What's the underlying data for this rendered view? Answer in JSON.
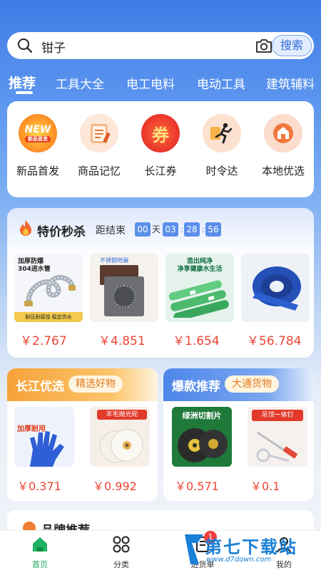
{
  "search": {
    "query": "钳子",
    "button_label": "搜索"
  },
  "tabs": [
    {
      "label": "推荐",
      "active": true
    },
    {
      "label": "工具大全"
    },
    {
      "label": "电工电料"
    },
    {
      "label": "电动工具"
    },
    {
      "label": "建筑辅料"
    }
  ],
  "shortcuts": [
    {
      "label": "新品首发",
      "badge_text": "NEW",
      "badge_sub": "新品首发",
      "icon": "new-badge-icon"
    },
    {
      "label": "商品记忆",
      "icon": "memory-notebook-icon"
    },
    {
      "label": "长江券",
      "badge_text": "券",
      "icon": "coupon-icon"
    },
    {
      "label": "时令达",
      "icon": "runner-icon"
    },
    {
      "label": "本地优选",
      "icon": "local-store-icon"
    }
  ],
  "flash_sale": {
    "title": "特价秒杀",
    "countdown_label": "距结束",
    "days": "00",
    "day_unit": "天",
    "hours": "03",
    "minutes": "28",
    "seconds": "56",
    "products": [
      {
        "price": "￥2.767",
        "caption_top": "加厚防爆",
        "caption_top2": "304进水管",
        "caption_bottom": "耐压耐腐蚀 稳定供水"
      },
      {
        "price": "￥4.851",
        "caption_top": "不锈钢地漏"
      },
      {
        "price": "￥1.654",
        "caption_top": "造出纯净",
        "caption_top2": "净享健康水生活"
      },
      {
        "price": "￥56.784"
      }
    ]
  },
  "changjiang": {
    "title": "长江优选",
    "pill": "精选好物",
    "products": [
      {
        "price": "￥0.371",
        "caption": "加厚耐用"
      },
      {
        "price": "￥0.992",
        "caption": "羊毛抛光轮"
      }
    ]
  },
  "hot": {
    "title": "爆款推荐",
    "pill": "大通货物",
    "products": [
      {
        "price": "￥0.571",
        "caption": "绿洲切割片"
      },
      {
        "price": "￥0.1",
        "caption": "吊顶一体钉"
      }
    ]
  },
  "brand": {
    "title": "品牌推荐"
  },
  "bottom_nav": [
    {
      "label": "首页",
      "active": true
    },
    {
      "label": "分类"
    },
    {
      "label": "进货单",
      "badge": "1"
    },
    {
      "label": "我的"
    }
  ],
  "watermark": {
    "title": "第七下载站",
    "url": "www.d7down.com"
  },
  "colors": {
    "primary_blue": "#3f7de6",
    "price_red": "#ee4433",
    "orange": "#f7a23a",
    "nav_active": "#17a65a"
  }
}
